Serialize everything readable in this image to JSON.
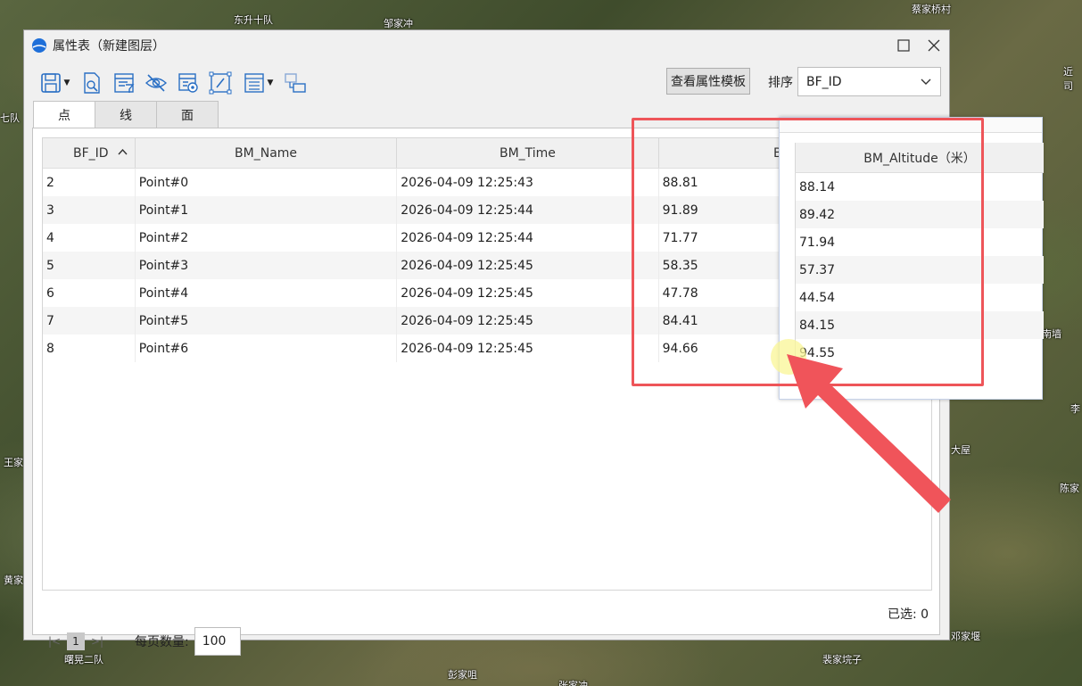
{
  "map_labels": [
    "东升十队",
    "邹家冲",
    "蔡家桥村",
    "近司",
    "七队",
    "王家",
    "黄家",
    "南墙",
    "李",
    "大屋",
    "陈家",
    "邓家堰",
    "曙晃二队",
    "彭家咀",
    "裴家垸子",
    "张家冲"
  ],
  "window": {
    "title": "属性表（新建图层）",
    "logo_icon": "app-logo-icon",
    "maximize_icon": "maximize-icon",
    "close_icon": "close-icon"
  },
  "toolbar": {
    "tools": [
      "save-icon",
      "preview-icon",
      "filter-icon",
      "hide-icon",
      "locate-icon",
      "edit-icon",
      "field-list-icon",
      "export-icon"
    ],
    "template_button": "查看属性模板",
    "sort_label": "排序",
    "sort_value": "BF_ID"
  },
  "tabs": [
    "点",
    "线",
    "面"
  ],
  "table": {
    "columns": [
      "BF_ID",
      "BM_Name",
      "BM_Time",
      "BM_Alt"
    ],
    "rows": [
      [
        "2",
        "Point#0",
        "2026-04-09 12:25:43",
        "88.81"
      ],
      [
        "3",
        "Point#1",
        "2026-04-09 12:25:44",
        "91.89"
      ],
      [
        "4",
        "Point#2",
        "2026-04-09 12:25:44",
        "71.77"
      ],
      [
        "5",
        "Point#3",
        "2026-04-09 12:25:45",
        "58.35"
      ],
      [
        "6",
        "Point#4",
        "2026-04-09 12:25:45",
        "47.78"
      ],
      [
        "7",
        "Point#5",
        "2026-04-09 12:25:45",
        "84.41"
      ],
      [
        "8",
        "Point#6",
        "2026-04-09 12:25:45",
        "94.66"
      ]
    ]
  },
  "pager": {
    "first_icon": "first-page-icon",
    "current_page": "1",
    "last_icon": "last-page-icon",
    "per_page_label": "每页数量:",
    "per_page_value": "100",
    "selected_label": "已选: 0"
  },
  "zoom_popup": {
    "header": "BM_Altitude（米）",
    "values": [
      "88.14",
      "89.42",
      "71.94",
      "57.37",
      "44.54",
      "84.15",
      "94.55"
    ]
  },
  "colors": {
    "highlight": "#ee5559",
    "accent": "#1e6fd9"
  }
}
